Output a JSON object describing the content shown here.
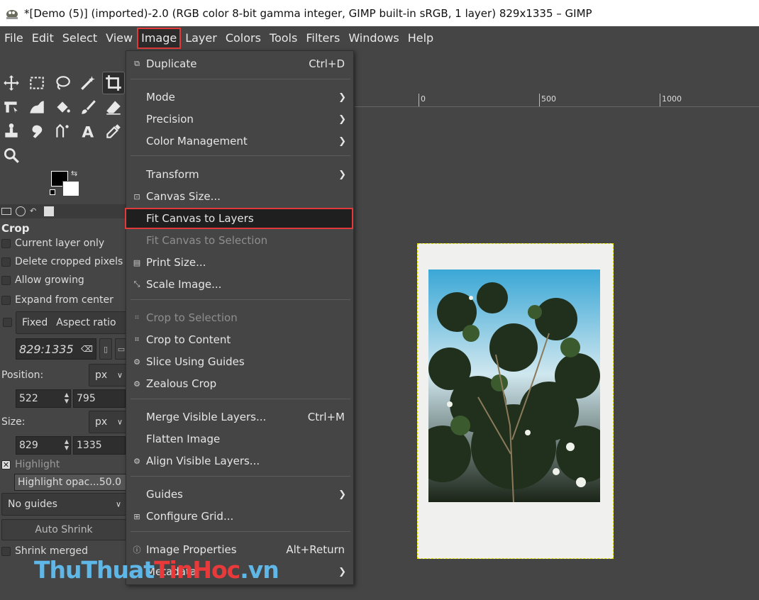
{
  "window": {
    "title": "*[Demo (5)] (imported)-2.0 (RGB color 8-bit gamma integer, GIMP built-in sRGB, 1 layer) 829x1335 – GIMP"
  },
  "menubar": {
    "items": [
      "File",
      "Edit",
      "Select",
      "View",
      "Image",
      "Layer",
      "Colors",
      "Tools",
      "Filters",
      "Windows",
      "Help"
    ],
    "active": "Image"
  },
  "tool_options": {
    "title": "Crop",
    "current_layer_only": "Current layer only",
    "delete_cropped": "Delete cropped pixels",
    "allow_growing": "Allow growing",
    "expand_from_center": "Expand from center",
    "fixed": "Fixed",
    "fixed_mode": "Aspect ratio",
    "ratio_value": "829:1335",
    "position_label": "Position:",
    "position_unit": "px",
    "position_x": "522",
    "position_y": "795",
    "size_label": "Size:",
    "size_unit": "px",
    "size_w": "829",
    "size_h": "1335",
    "highlight": "Highlight",
    "highlight_opacity_label": "Highlight opac...",
    "highlight_opacity_value": "50.0",
    "guides": "No guides",
    "auto_shrink": "Auto Shrink",
    "shrink_merged": "Shrink merged"
  },
  "ruler": {
    "labels": [
      "0",
      "500",
      "1000"
    ]
  },
  "image_menu": {
    "items": [
      {
        "label": "Duplicate",
        "shortcut": "Ctrl+D",
        "icon": "duplicate-icon"
      },
      {
        "label": "Mode",
        "submenu": true
      },
      {
        "label": "Precision",
        "submenu": true
      },
      {
        "label": "Color Management",
        "submenu": true
      },
      {
        "label": "Transform",
        "submenu": true
      },
      {
        "label": "Canvas Size...",
        "icon": "canvas-size-icon"
      },
      {
        "label": "Fit Canvas to Layers",
        "highlighted": true
      },
      {
        "label": "Fit Canvas to Selection",
        "disabled": true
      },
      {
        "label": "Print Size...",
        "icon": "print-icon"
      },
      {
        "label": "Scale Image...",
        "icon": "scale-icon"
      },
      {
        "label": "Crop to Selection",
        "disabled": true,
        "icon": "crop-icon"
      },
      {
        "label": "Crop to Content",
        "icon": "crop-icon"
      },
      {
        "label": "Slice Using Guides",
        "icon": "slice-icon"
      },
      {
        "label": "Zealous Crop",
        "icon": "zealous-icon"
      },
      {
        "label": "Merge Visible Layers...",
        "shortcut": "Ctrl+M"
      },
      {
        "label": "Flatten Image"
      },
      {
        "label": "Align Visible Layers...",
        "icon": "align-icon"
      },
      {
        "label": "Guides",
        "submenu": true
      },
      {
        "label": "Configure Grid...",
        "icon": "grid-icon"
      },
      {
        "label": "Image Properties",
        "shortcut": "Alt+Return",
        "icon": "info-icon"
      },
      {
        "label": "Metadata",
        "submenu": true
      }
    ]
  },
  "watermark": {
    "part1": "ThuThuat",
    "part2": "TinHoc",
    "part3": ".vn"
  }
}
